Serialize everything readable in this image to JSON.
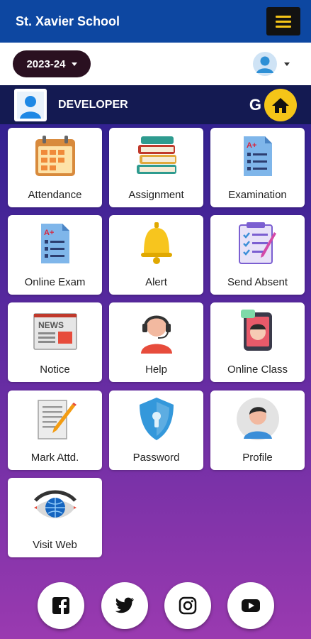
{
  "app": {
    "title": "St. Xavier School"
  },
  "session": {
    "year": "2023-24"
  },
  "user": {
    "name": "DEVELOPER",
    "badge": "G"
  },
  "tiles": [
    {
      "label": "Attendance",
      "icon": "calendar-icon"
    },
    {
      "label": "Assignment",
      "icon": "books-icon"
    },
    {
      "label": "Examination",
      "icon": "exam-paper-icon"
    },
    {
      "label": "Online Exam",
      "icon": "exam-paper-icon"
    },
    {
      "label": "Alert",
      "icon": "bell-icon"
    },
    {
      "label": "Send Absent",
      "icon": "checklist-icon"
    },
    {
      "label": "Notice",
      "icon": "newspaper-icon"
    },
    {
      "label": "Help",
      "icon": "headset-icon"
    },
    {
      "label": "Online Class",
      "icon": "video-call-icon"
    },
    {
      "label": "Mark Attd.",
      "icon": "pencil-paper-icon"
    },
    {
      "label": "Password",
      "icon": "shield-lock-icon"
    },
    {
      "label": "Profile",
      "icon": "profile-icon"
    },
    {
      "label": "Visit Web",
      "icon": "eye-globe-icon"
    }
  ],
  "social": [
    "facebook-icon",
    "twitter-icon",
    "instagram-icon",
    "youtube-icon"
  ],
  "colors": {
    "appbar": "#0d47a1",
    "menu_lines": "#f5c518",
    "home_button": "#f5c518",
    "dev_bar": "#141a52"
  }
}
